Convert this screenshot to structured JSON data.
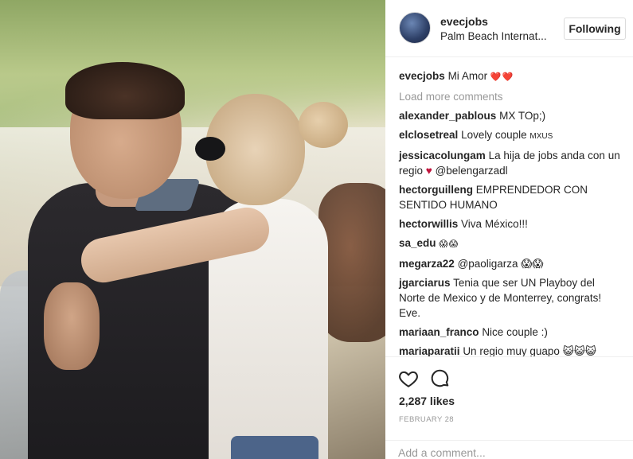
{
  "post": {
    "username": "evecjobs",
    "location": "Palm Beach Internat...",
    "follow_label": "Following"
  },
  "caption": {
    "username": "evecjobs",
    "text": "Mi Amor",
    "emoji": "❤️❤️"
  },
  "load_more": "Load more comments",
  "comments": [
    {
      "username": "alexander_pablous",
      "text": "MX TOp;)"
    },
    {
      "username": "elclosetreal",
      "text": "Lovely couple",
      "suffix": "MXUS"
    },
    {
      "username": "jessicacolungam",
      "text": "La hija de jobs anda con un regio",
      "heart": "♥",
      "mention": "@belengarzadl"
    },
    {
      "username": "hectorguilleng",
      "text": "EMPRENDEDOR CON SENTIDO HUMANO"
    },
    {
      "username": "hectorwillis",
      "text": "Viva México!!!"
    },
    {
      "username": "sa_edu",
      "text": "😱😱"
    },
    {
      "username": "megarza22",
      "text": "@paoligarza 😱😱"
    },
    {
      "username": "jgarciarus",
      "text": "Tenia que ser UN Playboy del Norte de Mexico y de Monterrey, congrats! Eve."
    },
    {
      "username": "mariaan_franco",
      "text": "Nice couple :)"
    },
    {
      "username": "mariaparatii",
      "text": "Un regio muy guapo 😺😺😺"
    }
  ],
  "likes": "2,287 likes",
  "date": "FEBRUARY 28",
  "add_comment_placeholder": "Add a comment...",
  "icons": {
    "like": "heart-icon",
    "comment": "comment-bubble-icon"
  },
  "colors": {
    "text": "#262626",
    "muted": "#999999",
    "heart": "#c0143c",
    "border": "#efefef"
  }
}
